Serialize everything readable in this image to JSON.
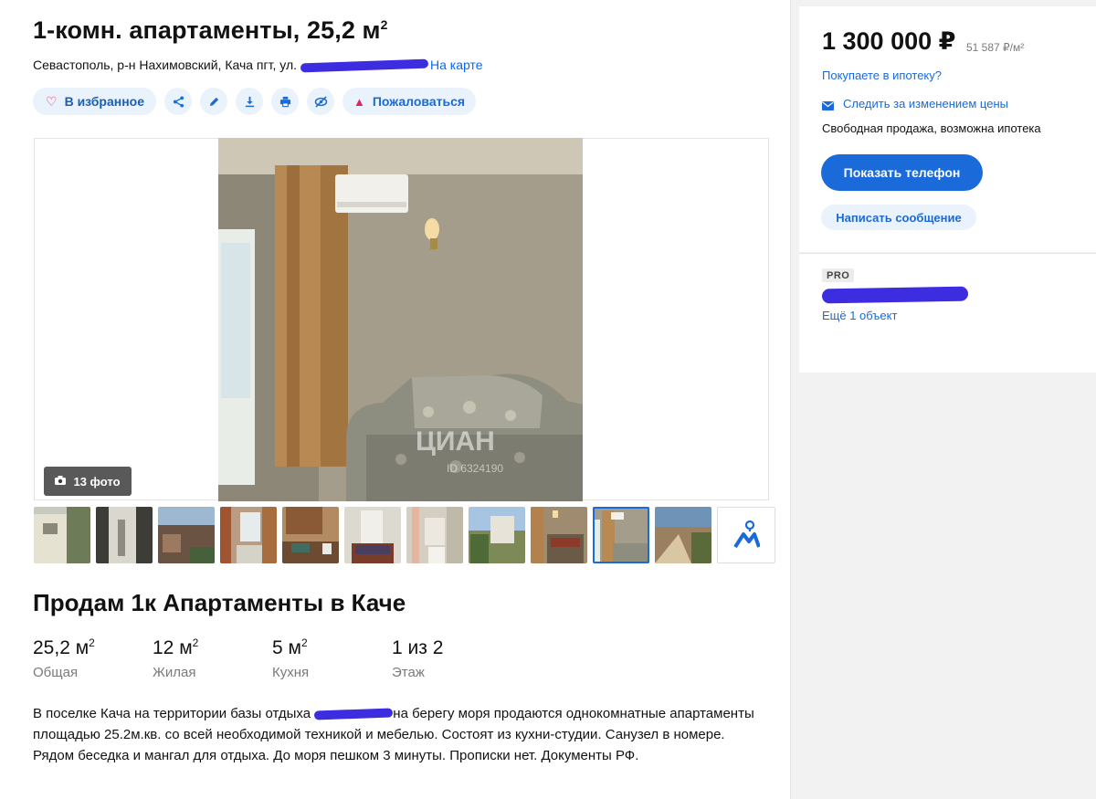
{
  "listing": {
    "title": "1-комн. апартаменты, 25,2 м",
    "title_sup": "2",
    "address": "Севастополь, р-н Нахимовский, Кача пгт, ул.",
    "map_link": "На карте",
    "favorite_label": "В избранное",
    "report_label": "Пожаловаться",
    "photo_count": "13 фото",
    "subtitle": "Продам 1к Апартаменты в Каче",
    "facts": [
      {
        "value": "25,2 м",
        "sup": "2",
        "label": "Общая"
      },
      {
        "value": "12 м",
        "sup": "2",
        "label": "Жилая"
      },
      {
        "value": "5 м",
        "sup": "2",
        "label": "Кухня"
      },
      {
        "value": "1 из 2",
        "sup": "",
        "label": "Этаж"
      }
    ],
    "description_part1": "В поселке Кача на территории базы отдыха ",
    "description_part2": "на берегу моря продаются однокомнатные апартаменты площадью 25.2м.кв. со всей необходимой техникой и мебелью. Состоят из кухни-студии. Санузел в номере. Рядом беседка и мангал для отдыха. До моря пешком 3 минуты. Прописки нет. Документы РФ.",
    "watermark": "ЦИАН",
    "watermark_id": "ID 6324190"
  },
  "sidebar": {
    "price": "1 300 000 ₽",
    "price_per_m": "51 587 ₽/м²",
    "mortgage_link": "Покупаете в ипотеку?",
    "watch_link": "Следить за изменением цены",
    "sale_note": "Свободная продажа, возможна ипотека",
    "phone_button": "Показать телефон",
    "message_button": "Написать сообщение",
    "pro_badge": "PRO",
    "more_link": "Ещё 1 объект"
  },
  "icons": {
    "favorite": "heart-icon",
    "share": "share-icon",
    "edit": "pencil-icon",
    "download": "download-icon",
    "print": "printer-icon",
    "hide": "eye-slash-icon",
    "report": "warning-icon",
    "camera": "camera-icon",
    "map_pin": "map-pin-icon",
    "envelope": "envelope-icon"
  },
  "colors": {
    "accent": "#1a6ad9",
    "accent_light": "#eaf2fc",
    "heart": "#e0245e",
    "redaction": "#3d2de0"
  }
}
